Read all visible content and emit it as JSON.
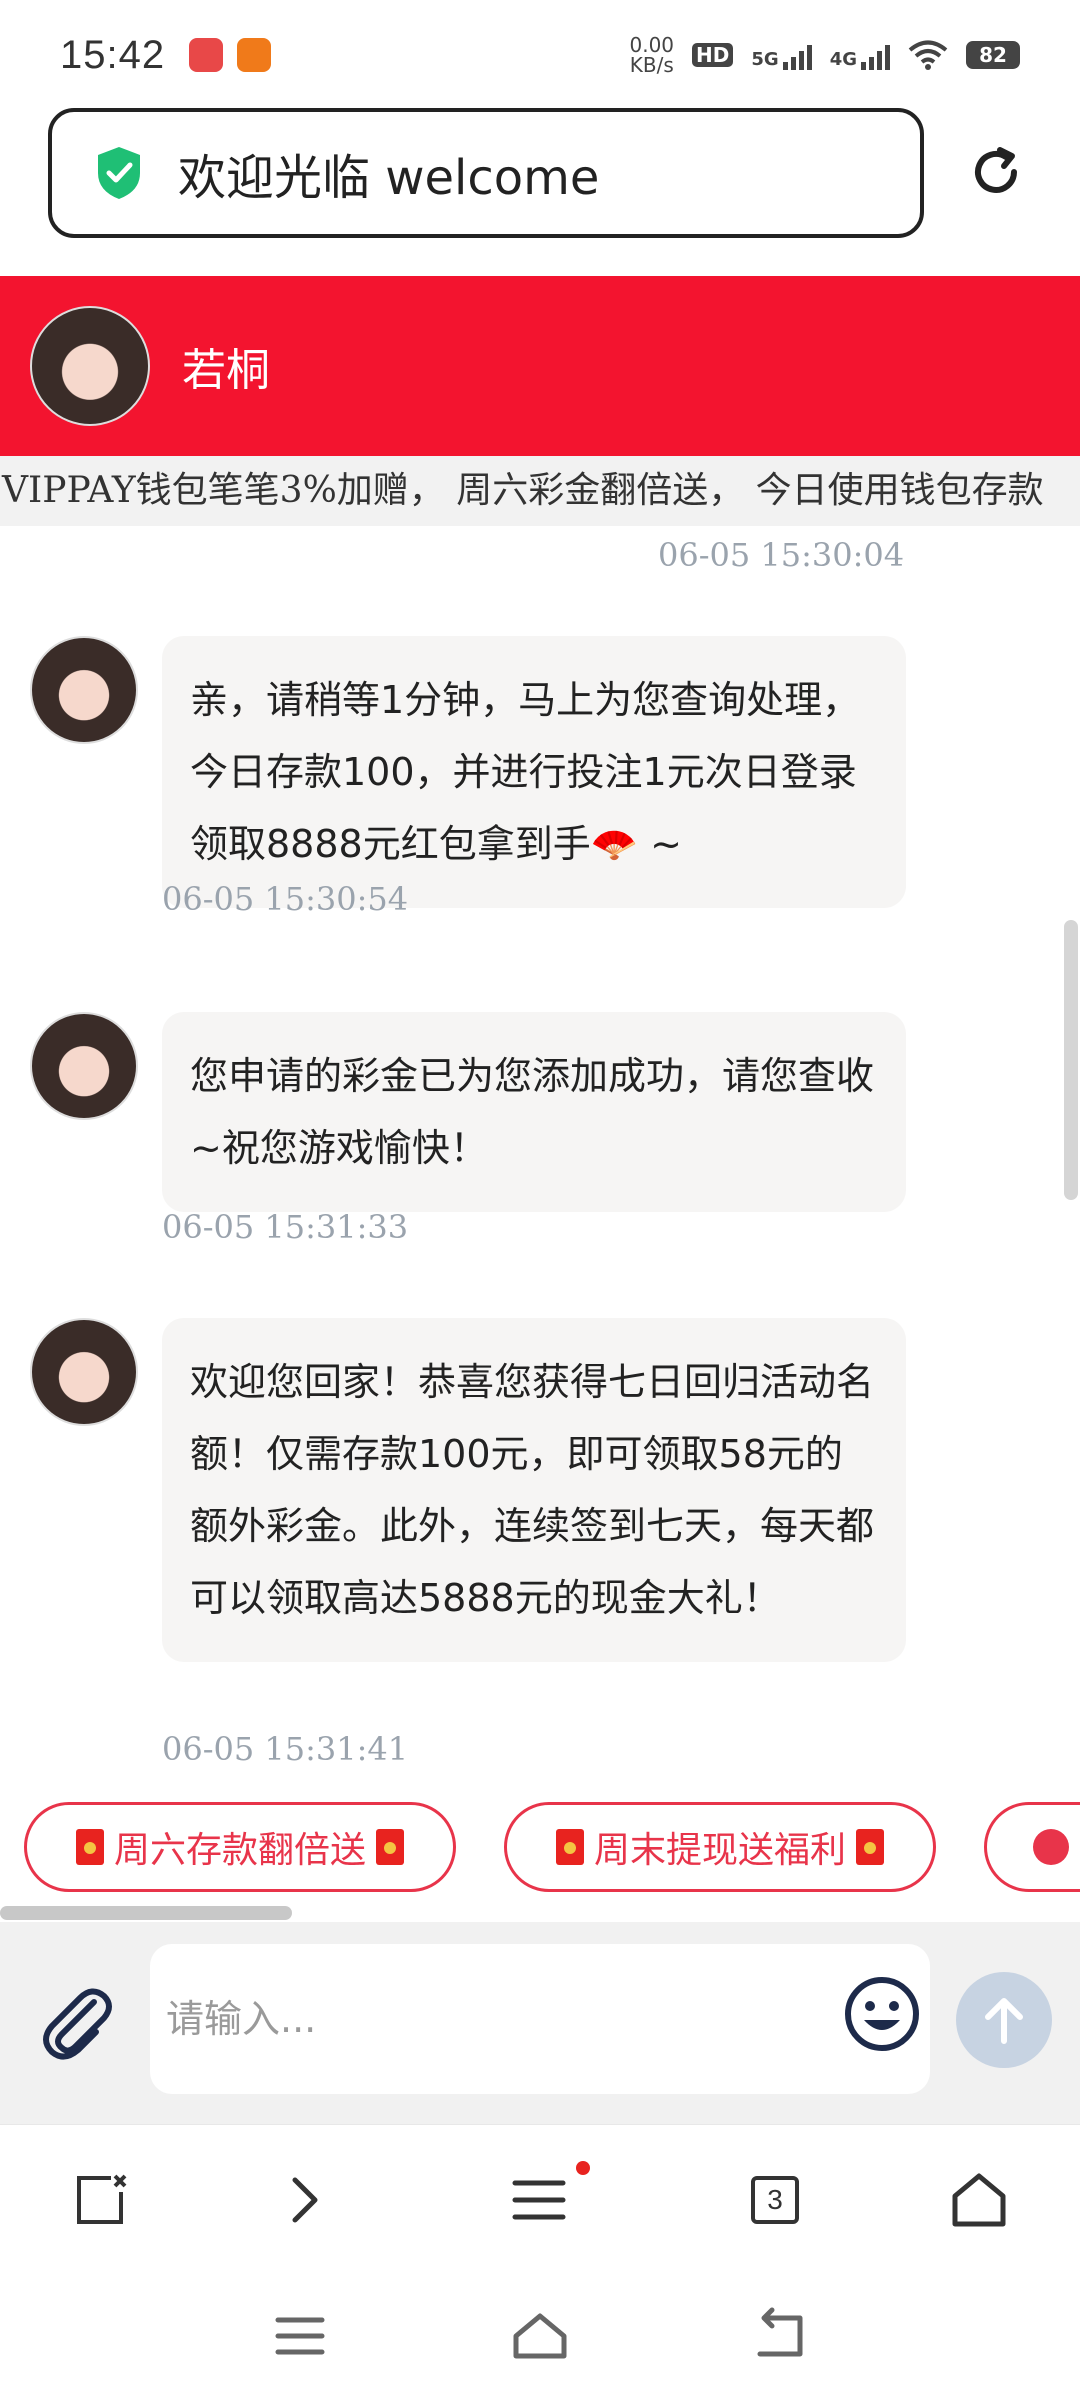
{
  "status_bar": {
    "time": "15:42",
    "net_speed_value": "0.00",
    "net_speed_unit": "KB/s",
    "hd": "HD",
    "sim_5g": "5G",
    "sim_4g": "4G",
    "battery": "82"
  },
  "url_bar": {
    "title": "欢迎光临 welcome",
    "secure_icon": "shield-check-icon",
    "reload_icon": "reload-icon"
  },
  "header": {
    "name": "若桐"
  },
  "marquee": {
    "text": "VIPPAY钱包笔笔3%加赠， 周六彩金翻倍送， 今日使用钱包存款"
  },
  "chat": {
    "top_timestamp": "06-05 15:30:04",
    "messages": [
      {
        "text": "亲，请稍等1分钟，马上为您查询处理，今日存款100，并进行投注1元次日登录领取8888元红包拿到手🪭 ~",
        "timestamp": "06-05 15:30:54"
      },
      {
        "text": "您申请的彩金已为您添加成功，请您查收~祝您游戏愉快！",
        "timestamp": "06-05 15:31:33"
      },
      {
        "text": "欢迎您回家！恭喜您获得七日回归活动名额！仅需存款100元，即可领取58元的额外彩金。此外，连续签到七天，每天都可以领取高达5888元的现金大礼！",
        "timestamp": "06-05 15:31:41"
      }
    ]
  },
  "quick_replies": [
    {
      "label": "周六存款翻倍送"
    },
    {
      "label": "周末提现送福利"
    },
    {
      "label": ""
    }
  ],
  "input": {
    "placeholder": "请输入..."
  },
  "browser_bar": {
    "tab_count": "3"
  },
  "colors": {
    "header_red": "#f3142f",
    "chip_red": "#e8344a",
    "timestamp_gray": "#9aa3ad",
    "bubble_bg": "#f6f5f4"
  }
}
